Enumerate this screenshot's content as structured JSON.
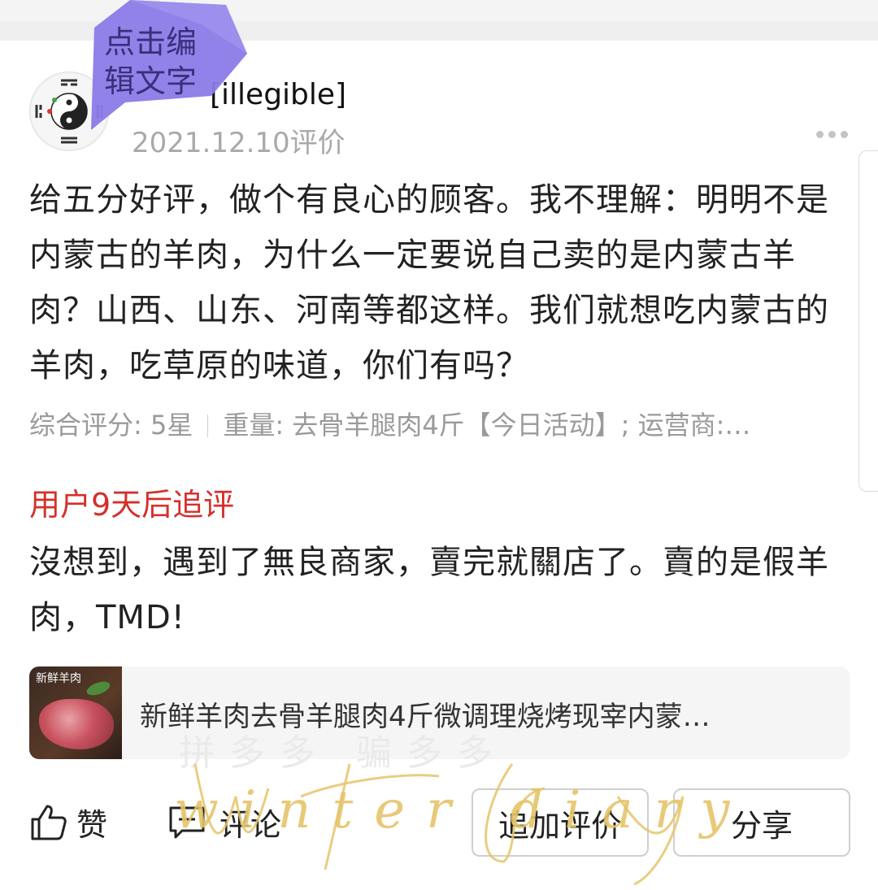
{
  "review": {
    "username_partial": "[illegible]",
    "date": "2021.12.10评价",
    "text": "给五分好评，做个有良心的顾客。我不理解：明明不是内蒙古的羊肉，为什么一定要说自己卖的是内蒙古羊肉？山西、山东、河南等都这样。我们就想吃内蒙古的羊肉，吃草原的味道，你们有吗？",
    "rating": "综合评分: 5星",
    "spec": "重量: 去骨羊腿肉4斤【今日活动】; 运营商:…",
    "followup_title": "用户9天后追评",
    "followup_text": "沒想到，遇到了無良商家，賣完就關店了。賣的是假羊肉，TMD!"
  },
  "product": {
    "thumb_label": "新鲜羊肉",
    "title": "新鲜羊肉去骨羊腿肉4斤微调理烧烤现宰内蒙…"
  },
  "watermark": {
    "ghost_text": "拼多多 骗多多",
    "signature": "winter diary"
  },
  "actions": {
    "like_label": "赞",
    "comment_label": "评论",
    "add_review_label": "追加评价",
    "share_label": "分享"
  },
  "overlay": {
    "edit_text": "点击编辑文字"
  },
  "colors": {
    "accent_red": "#d4302b",
    "overlay_purple": "#8a7be8",
    "signature_gold": "#e5c46a"
  }
}
